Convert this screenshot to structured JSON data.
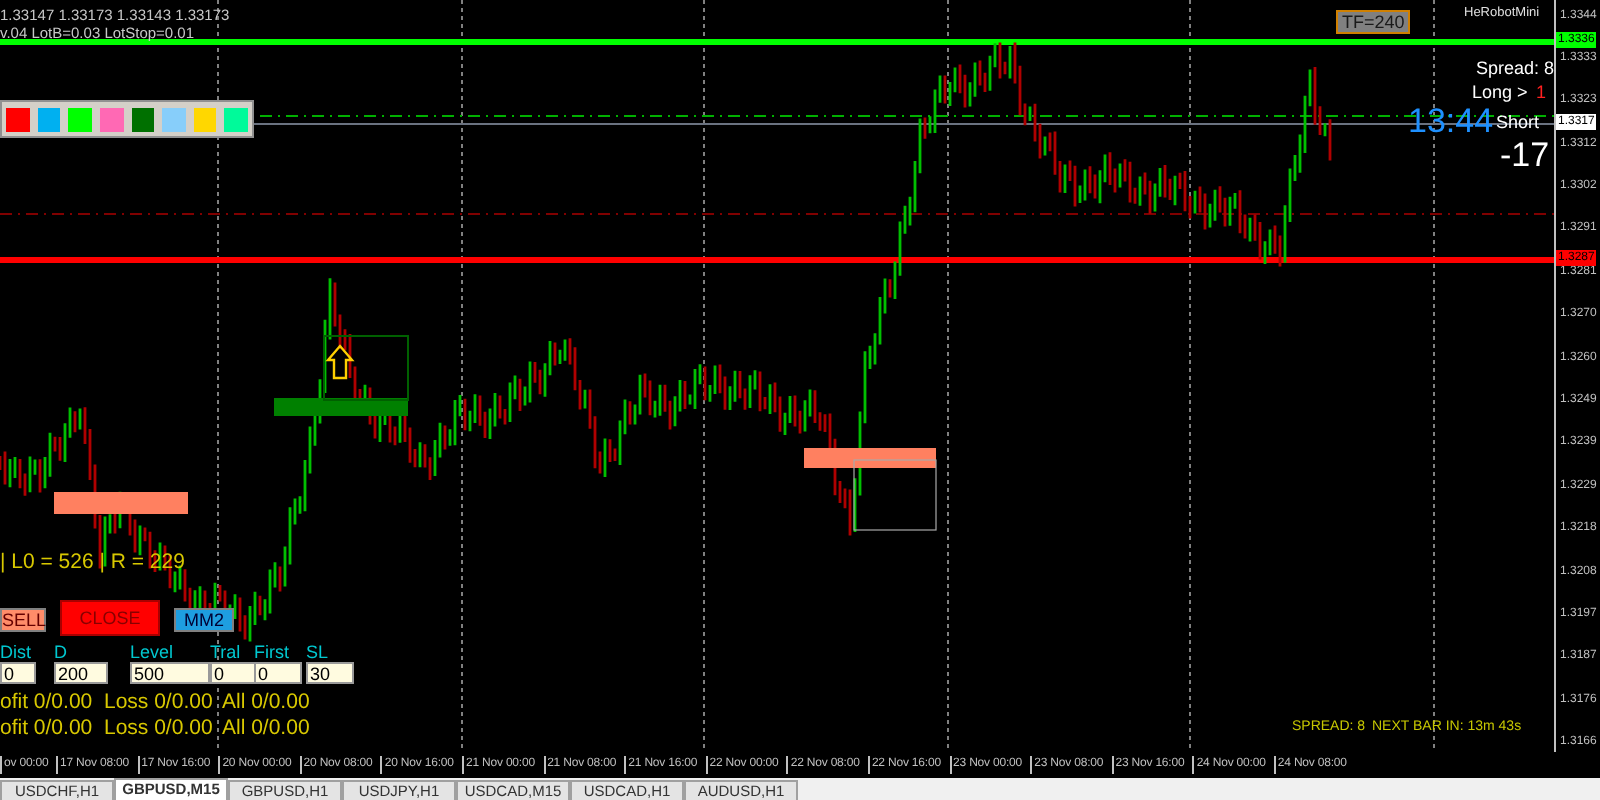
{
  "chart_header": {
    "ohlc": "1.33147 1.33173 1.33143 1.33173",
    "settings": "v.04  LotB=0.03  LotStop=0.01"
  },
  "color_palette": [
    {
      "color": "#ff0000"
    },
    {
      "color": "#00b0f0"
    },
    {
      "color": "#00ff00"
    },
    {
      "color": "#ff69b4"
    },
    {
      "color": "#007000"
    },
    {
      "color": "#87cefa"
    },
    {
      "color": "#ffd700"
    },
    {
      "color": "#00fa9a"
    }
  ],
  "timeframe_label": "TF=240",
  "robot_name": "HeRobotMini",
  "info": {
    "spread": "Spread: 8",
    "long_label": "Long >",
    "long_value": "1",
    "short_label": "Short",
    "clock": "13:44",
    "short_value": "-17"
  },
  "levels_text": "| L0 = 526 | R = 229",
  "buttons": [
    {
      "label": "SELL",
      "kind": "sell"
    },
    {
      "label": "CLOSE",
      "kind": "close"
    },
    {
      "label": "MM2",
      "kind": "mm"
    }
  ],
  "params": [
    {
      "label": "Dist",
      "value": "0"
    },
    {
      "label": "D",
      "value": "200"
    },
    {
      "label": "Level",
      "value": "500"
    },
    {
      "label": "Tral",
      "value": "0"
    },
    {
      "label": "First",
      "value": "0"
    },
    {
      "label": "SL",
      "value": "30"
    }
  ],
  "stats": [
    {
      "profit": "ofit 0/0.00",
      "loss": "Loss 0/0.00",
      "all": "All 0/0.00"
    },
    {
      "profit": "ofit 0/0.00",
      "loss": "Loss 0/0.00",
      "all": "All 0/0.00"
    }
  ],
  "status": {
    "spread": "SPREAD: 8",
    "next_bar": "NEXT BAR IN: 13m 43s"
  },
  "price_axis": [
    {
      "label": "1.3344",
      "kind": "tick"
    },
    {
      "label": "1.3336",
      "kind": "green_line"
    },
    {
      "label": "1.3333",
      "kind": "tick"
    },
    {
      "label": "1.3323",
      "kind": "tick"
    },
    {
      "label": "1.3317",
      "kind": "price_line"
    },
    {
      "label": "1.3312",
      "kind": "tick"
    },
    {
      "label": "1.3302",
      "kind": "tick"
    },
    {
      "label": "1.3291",
      "kind": "tick"
    },
    {
      "label": "1.3287",
      "kind": "red_line"
    },
    {
      "label": "1.3281",
      "kind": "tick"
    },
    {
      "label": "1.3270",
      "kind": "tick"
    },
    {
      "label": "1.3260",
      "kind": "tick"
    },
    {
      "label": "1.3249",
      "kind": "tick"
    },
    {
      "label": "1.3239",
      "kind": "tick"
    },
    {
      "label": "1.3229",
      "kind": "tick"
    },
    {
      "label": "1.3218",
      "kind": "tick"
    },
    {
      "label": "1.3208",
      "kind": "tick"
    },
    {
      "label": "1.3197",
      "kind": "tick"
    },
    {
      "label": "1.3187",
      "kind": "tick"
    },
    {
      "label": "1.3176",
      "kind": "tick"
    },
    {
      "label": "1.3166",
      "kind": "tick"
    }
  ],
  "time_axis": [
    "ov 00:00",
    "17 Nov 08:00",
    "17 Nov 16:00",
    "20 Nov 00:00",
    "20 Nov 08:00",
    "20 Nov 16:00",
    "21 Nov 00:00",
    "21 Nov 08:00",
    "21 Nov 16:00",
    "22 Nov 00:00",
    "22 Nov 08:00",
    "22 Nov 16:00",
    "23 Nov 00:00",
    "23 Nov 08:00",
    "23 Nov 16:00",
    "24 Nov 00:00",
    "24 Nov 08:00"
  ],
  "tabs": [
    {
      "label": "USDCHF,H1",
      "selected": false
    },
    {
      "label": "GBPUSD,M15",
      "selected": true
    },
    {
      "label": "GBPUSD,H1",
      "selected": false
    },
    {
      "label": "USDJPY,H1",
      "selected": false
    },
    {
      "label": "USDCAD,M15",
      "selected": false
    },
    {
      "label": "USDCAD,H1",
      "selected": false
    },
    {
      "label": "AUDUSD,H1",
      "selected": false
    }
  ]
}
